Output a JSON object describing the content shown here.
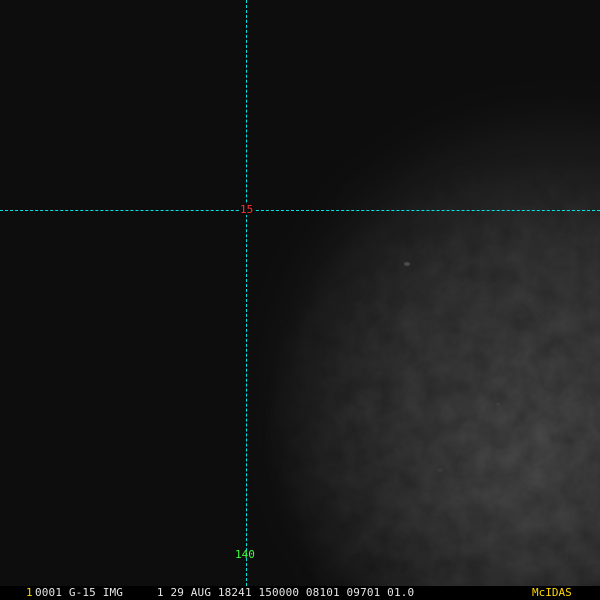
{
  "image": {
    "satellite": "G-15",
    "band": "IMG"
  },
  "grid": {
    "latitude_label": "15",
    "longitude_label": "140",
    "line_color": "#00e5e5",
    "latitude_label_color": "#ff3030",
    "longitude_label_color": "#3cff3c"
  },
  "status_bar": {
    "frame_number": "1",
    "text": "0001 G-15 IMG     1 29 AUG 18241 150000 08101 09701 01.0",
    "logo": "McIDAS",
    "text_color": "#e6e6e6",
    "accent_color": "#ffd700"
  }
}
